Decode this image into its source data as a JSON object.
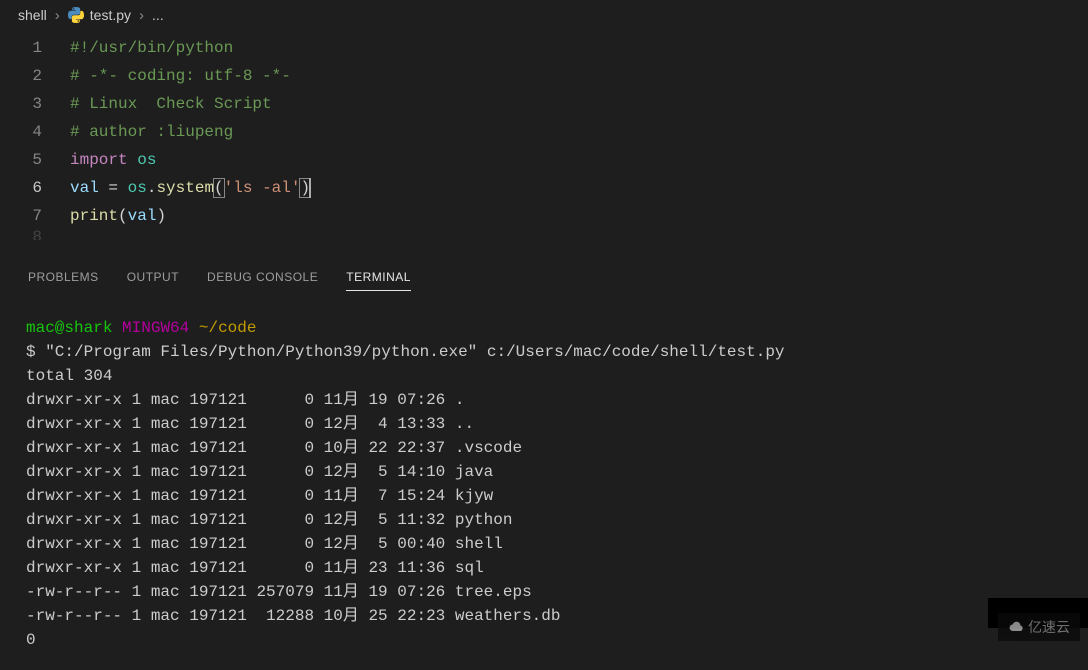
{
  "breadcrumb": {
    "folder": "shell",
    "file": "test.py",
    "extra": "..."
  },
  "editor": {
    "lines": [
      {
        "num": "1",
        "tokens": [
          {
            "cls": "tok-comment",
            "text": "#!/usr/bin/python"
          }
        ]
      },
      {
        "num": "2",
        "tokens": [
          {
            "cls": "tok-comment",
            "text": "# -*- coding: utf-8 -*-"
          }
        ]
      },
      {
        "num": "3",
        "tokens": [
          {
            "cls": "tok-comment",
            "text": "# Linux  Check Script"
          }
        ]
      },
      {
        "num": "4",
        "tokens": [
          {
            "cls": "tok-comment",
            "text": "# author :liupeng"
          }
        ]
      },
      {
        "num": "5",
        "tokens": [
          {
            "cls": "tok-keyword",
            "text": "import"
          },
          {
            "cls": "tok-punc",
            "text": " "
          },
          {
            "cls": "tok-module",
            "text": "os"
          }
        ]
      },
      {
        "num": "6",
        "tokens": [
          {
            "cls": "tok-var",
            "text": "val"
          },
          {
            "cls": "tok-punc",
            "text": " = "
          },
          {
            "cls": "tok-module",
            "text": "os"
          },
          {
            "cls": "tok-punc",
            "text": "."
          },
          {
            "cls": "tok-func",
            "text": "system"
          },
          {
            "cls": "tok-punc bracket-hl",
            "text": "("
          },
          {
            "cls": "tok-string",
            "text": "'ls -al'"
          },
          {
            "cls": "tok-punc bracket-hl",
            "text": ")"
          }
        ],
        "cursor_after": true,
        "active": true
      },
      {
        "num": "7",
        "tokens": [
          {
            "cls": "tok-func",
            "text": "print"
          },
          {
            "cls": "tok-punc",
            "text": "("
          },
          {
            "cls": "tok-var",
            "text": "val"
          },
          {
            "cls": "tok-punc",
            "text": ")"
          }
        ]
      },
      {
        "num": "8",
        "tokens": [
          {
            "cls": "tok-punc",
            "text": ""
          }
        ],
        "partial": true
      }
    ]
  },
  "panelTabs": {
    "problems": "PROBLEMS",
    "output": "OUTPUT",
    "debug": "DEBUG CONSOLE",
    "terminal": "TERMINAL"
  },
  "terminal": {
    "prompt_user": "mac@shark",
    "prompt_env": "MINGW64",
    "prompt_path": "~/code",
    "command_prefix": "$ ",
    "command": "\"C:/Program Files/Python/Python39/python.exe\" c:/Users/mac/code/shell/test.py",
    "output_lines": [
      "total 304",
      "drwxr-xr-x 1 mac 197121      0 11月 19 07:26 .",
      "drwxr-xr-x 1 mac 197121      0 12月  4 13:33 ..",
      "drwxr-xr-x 1 mac 197121      0 10月 22 22:37 .vscode",
      "drwxr-xr-x 1 mac 197121      0 12月  5 14:10 java",
      "drwxr-xr-x 1 mac 197121      0 11月  7 15:24 kjyw",
      "drwxr-xr-x 1 mac 197121      0 12月  5 11:32 python",
      "drwxr-xr-x 1 mac 197121      0 12月  5 00:40 shell",
      "drwxr-xr-x 1 mac 197121      0 11月 23 11:36 sql",
      "-rw-r--r-- 1 mac 197121 257079 11月 19 07:26 tree.eps",
      "-rw-r--r-- 1 mac 197121  12288 10月 25 22:23 weathers.db",
      "0"
    ]
  },
  "watermark": "亿速云"
}
